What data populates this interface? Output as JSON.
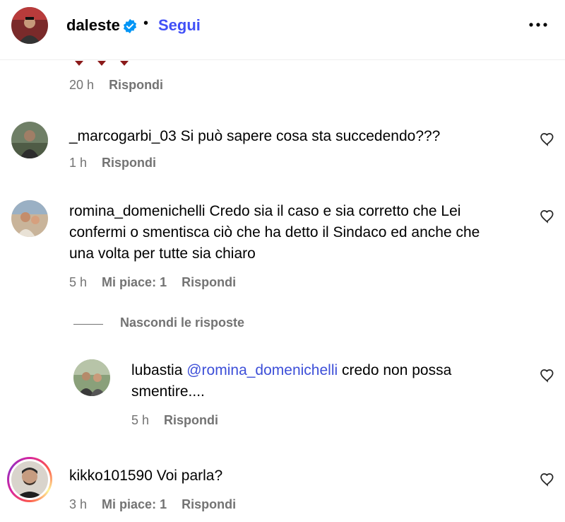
{
  "header": {
    "username": "daleste",
    "separator": "•",
    "follow_label": "Segui",
    "avatar_icon": "profile-photo",
    "verified_icon": "verified-badge-icon",
    "more_icon": "more-options-icon"
  },
  "colors": {
    "follow": "#4150f7",
    "verified": "#0095f6",
    "meta": "#737373",
    "mention": "#3d4fd8"
  },
  "comments": [
    {
      "time": "20 h",
      "reply_label": "Rispondi"
    },
    {
      "username": "_marcogarbi_03",
      "text": "Si può sapere cosa sta succedendo???",
      "time": "1 h",
      "reply_label": "Rispondi"
    },
    {
      "username": "romina_domenichelli",
      "text_line1": "Credo sia il caso e sia corretto che Lei",
      "text_line2": "confermi o smentisca ciò che ha detto il Sindaco ed anche che",
      "text_line3": "una volta per tutte sia chiaro",
      "time": "5 h",
      "likes": "Mi piace: 1",
      "reply_label": "Rispondi",
      "toggle_replies": "Nascondi le risposte",
      "replies": [
        {
          "username": "lubastia",
          "mention": "@romina_domenichelli",
          "text_line1": "credo non possa",
          "text_line2": "smentire....",
          "time": "5 h",
          "reply_label": "Rispondi"
        }
      ]
    },
    {
      "username": "kikko101590",
      "text": "Voi parla?",
      "time": "3 h",
      "likes": "Mi piace: 1",
      "reply_label": "Rispondi"
    }
  ]
}
